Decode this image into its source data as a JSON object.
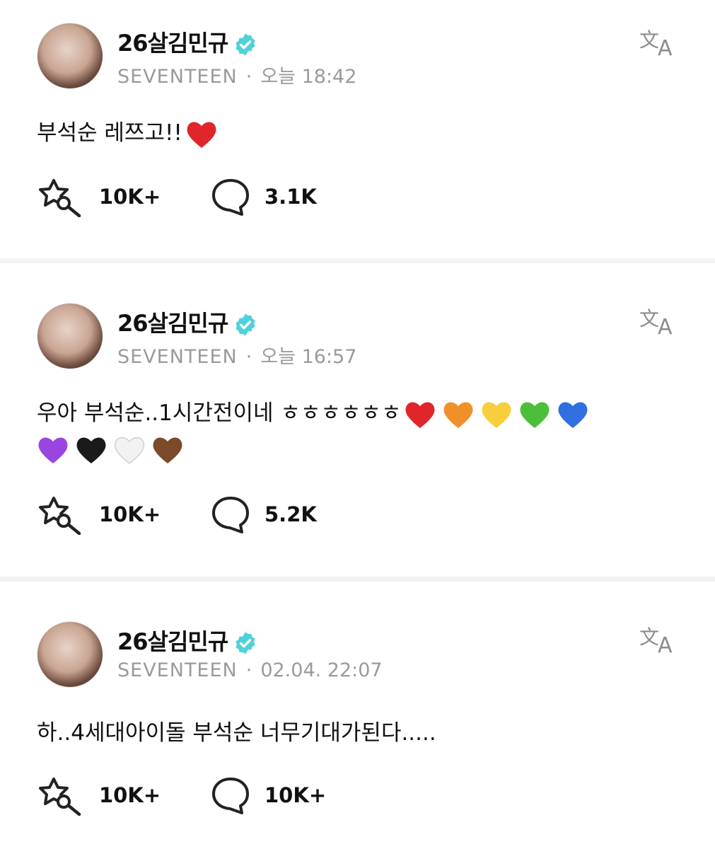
{
  "posts": [
    {
      "username": "26살김민규",
      "group": "SEVENTEEN",
      "separator": "·",
      "time": "오늘 18:42",
      "text": "부석순 레쯔고!!",
      "text_emoji": [
        "red"
      ],
      "hearts_row": [],
      "likes": "10K+",
      "comments": "3.1K"
    },
    {
      "username": "26살김민규",
      "group": "SEVENTEEN",
      "separator": "·",
      "time": "오늘 16:57",
      "text": "우아 부석순..1시간전이네 ㅎㅎㅎㅎㅎㅎ",
      "text_emoji": [
        "red",
        "orange",
        "yellow",
        "green",
        "blue"
      ],
      "hearts_row": [
        "purple",
        "black",
        "white",
        "brown"
      ],
      "likes": "10K+",
      "comments": "5.2K"
    },
    {
      "username": "26살김민규",
      "group": "SEVENTEEN",
      "separator": "·",
      "time": "02.04. 22:07",
      "text": "하..4세대아이돌 부석순 너무기대가된다.....",
      "text_emoji": [],
      "hearts_row": [],
      "likes": "10K+",
      "comments": "10K+"
    }
  ],
  "colors": {
    "verified": "#4fd1d9",
    "meta_text": "#9a9a9a",
    "divider": "#f3f3f3",
    "heart_red": "#e0262b",
    "heart_orange": "#f0902a",
    "heart_yellow": "#f7cf3c",
    "heart_green": "#4cbf3a",
    "heart_blue": "#2f6fe0",
    "heart_purple": "#9b45e0",
    "heart_black": "#1a1a1a",
    "heart_white": "#f2f2f2",
    "heart_brown": "#7a4a2a"
  },
  "icons": {
    "like": "star-pin-icon",
    "comment": "speech-bubble-icon",
    "translate": "translate-icon",
    "verified": "verified-badge-icon"
  }
}
